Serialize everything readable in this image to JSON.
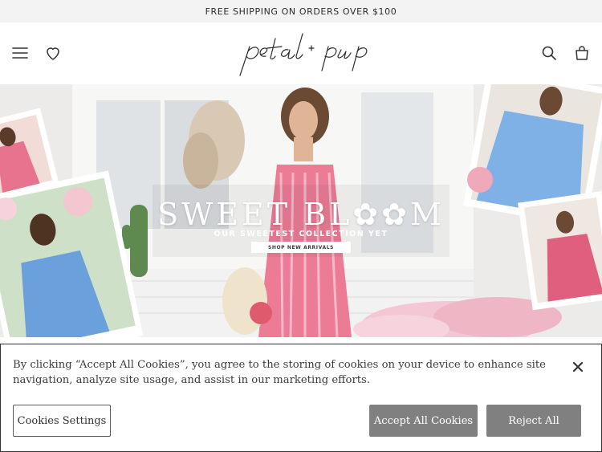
{
  "promo": {
    "text": "FREE SHIPPING ON ORDERS OVER $100"
  },
  "header": {
    "logo_alt": "petal + pup",
    "icons": [
      "menu-icon",
      "heart-icon",
      "search-icon",
      "bag-icon"
    ]
  },
  "hero": {
    "title": "SWEET BL✿✿M",
    "subtitle": "OUR SWEETEST COLLECTION YET",
    "button_label": "SHOP NEW ARRIVALS"
  },
  "cookie": {
    "text": "By clicking “Accept All Cookies”, you agree to the storing of cookies on your device to enhance site navigation, analyze site usage, and assist in our marketing efforts.",
    "settings_label": "Cookies Settings",
    "accept_label": "Accept All Cookies",
    "reject_label": "Reject All"
  },
  "colors": {
    "promo_bg": "#f3f3f3",
    "button_gray": "#808080",
    "text_dark": "#2b2b2b"
  }
}
